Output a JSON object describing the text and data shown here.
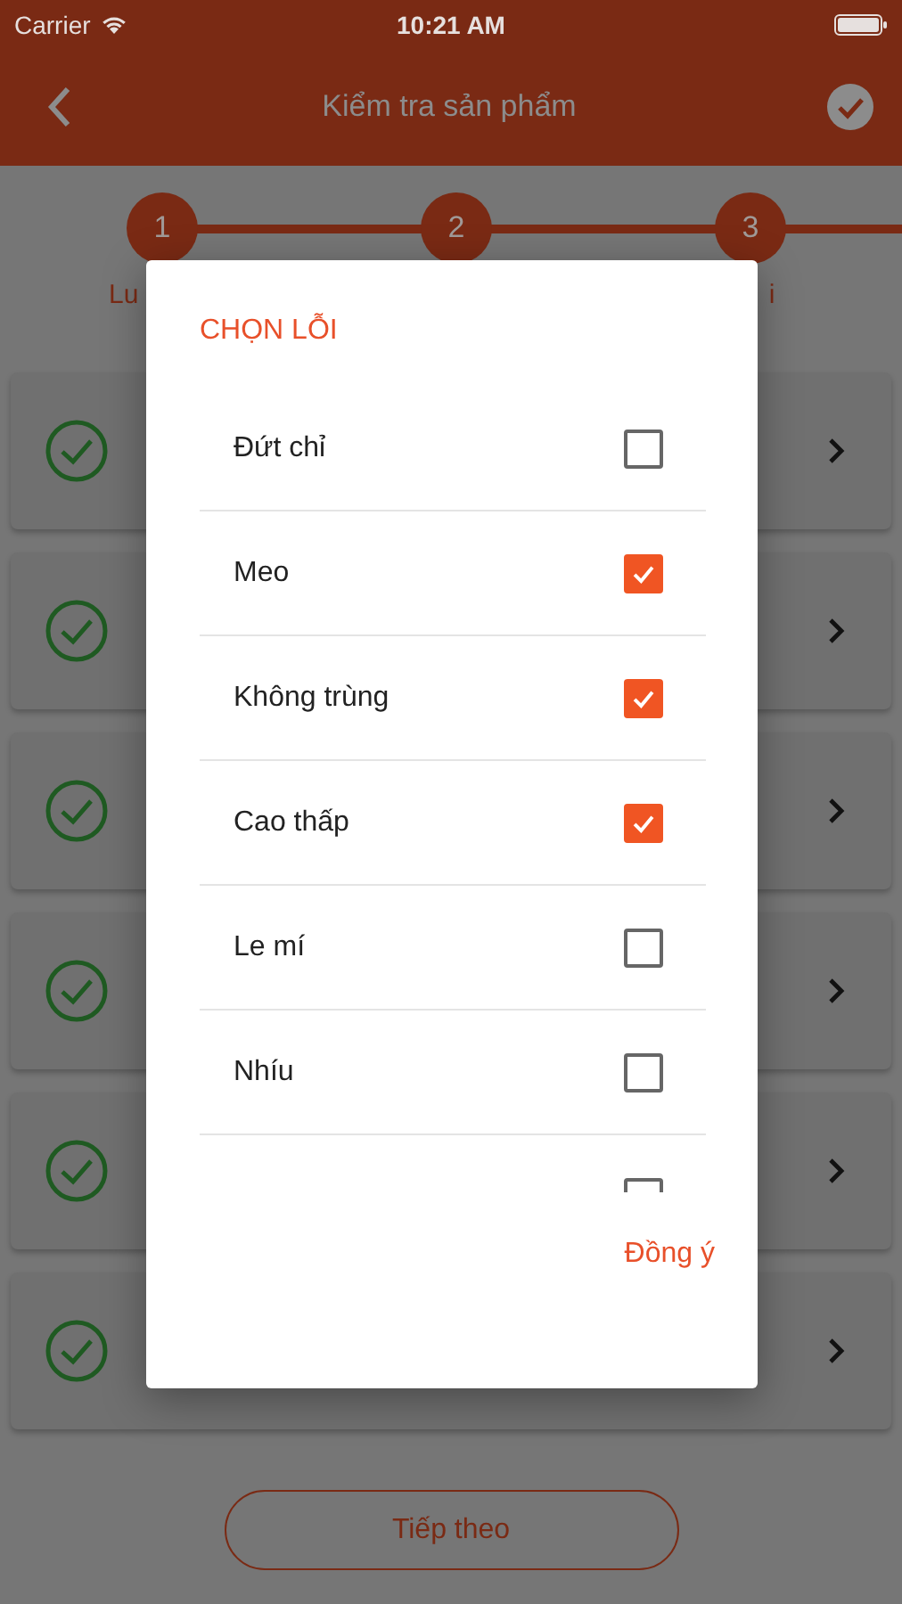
{
  "status_bar": {
    "carrier": "Carrier",
    "time": "10:21 AM"
  },
  "nav": {
    "title": "Kiểm tra sản phẩm"
  },
  "steps": [
    {
      "number": "1",
      "label": "Lu"
    },
    {
      "number": "2"
    },
    {
      "number": "3",
      "label": "i"
    }
  ],
  "cards": [
    {
      "done": true
    },
    {
      "done": true
    },
    {
      "done": true
    },
    {
      "done": true
    },
    {
      "done": true
    },
    {
      "done": true
    }
  ],
  "next_button": "Tiếp theo",
  "dialog": {
    "title": "CHỌN LỖI",
    "options": [
      {
        "label": "Đứt chỉ",
        "checked": false
      },
      {
        "label": "Meo",
        "checked": true
      },
      {
        "label": "Không trùng",
        "checked": true
      },
      {
        "label": "Cao thấp",
        "checked": true
      },
      {
        "label": "Le mí",
        "checked": false
      },
      {
        "label": "Nhíu",
        "checked": false
      },
      {
        "checked": false
      }
    ],
    "confirm": "Đồng ý"
  }
}
